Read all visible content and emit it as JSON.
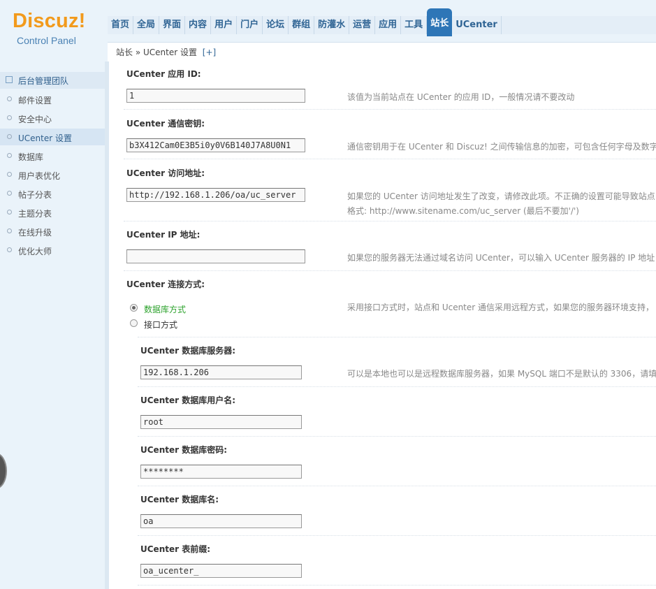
{
  "logo": {
    "main": "Discuz!",
    "sub": "Control Panel"
  },
  "nav": {
    "items": [
      "首页",
      "全局",
      "界面",
      "内容",
      "用户",
      "门户",
      "论坛",
      "群组",
      "防灌水",
      "运营",
      "应用",
      "工具",
      "站长",
      "UCenter"
    ],
    "active": "站长"
  },
  "breadcrumb": {
    "text": "站长 » UCenter 设置",
    "plus": "[+]"
  },
  "sidebar": {
    "group": "后台管理团队",
    "items": [
      "邮件设置",
      "安全中心",
      "UCenter 设置",
      "数据库",
      "用户表优化",
      "帖子分表",
      "主题分表",
      "在线升级",
      "优化大师"
    ],
    "active": "UCenter 设置"
  },
  "form": {
    "app_id": {
      "label": "UCenter 应用 ID:",
      "value": "1",
      "tip": "该值为当前站点在 UCenter 的应用 ID，一般情况请不要改动"
    },
    "comm_key": {
      "label": "UCenter 通信密钥:",
      "value": "b3X412Cam0E3B5i0y0V6B140J7A8U0N1",
      "tip": "通信密钥用于在 UCenter 和 Discuz! 之间传输信息的加密，可包含任何字母及数字"
    },
    "url": {
      "label": "UCenter 访问地址:",
      "value": "http://192.168.1.206/oa/uc_server",
      "tip1": "如果您的 UCenter 访问地址发生了改变，请修改此项。不正确的设置可能导致站点",
      "tip2": "格式: http://www.sitename.com/uc_server (最后不要加'/')"
    },
    "ip": {
      "label": "UCenter IP 地址:",
      "value": "",
      "tip": "如果您的服务器无法通过域名访问 UCenter，可以输入 UCenter 服务器的 IP 地址"
    },
    "connect": {
      "label": "UCenter 连接方式:",
      "option_db": "数据库方式",
      "option_api": "接口方式",
      "selected": "数据库方式",
      "tip": "采用接口方式时，站点和 Ucenter 通信采用远程方式，如果您的服务器环境支持，"
    },
    "db_host": {
      "label": "UCenter 数据库服务器:",
      "value": "192.168.1.206",
      "tip": "可以是本地也可以是远程数据库服务器，如果 MySQL 端口不是默认的 3306，请填"
    },
    "db_user": {
      "label": "UCenter 数据库用户名:",
      "value": "root"
    },
    "db_pass": {
      "label": "UCenter 数据库密码:",
      "value": "********"
    },
    "db_name": {
      "label": "UCenter 数据库名:",
      "value": "oa"
    },
    "db_prefix": {
      "label": "UCenter 表前缀:",
      "value": "oa_ucenter_"
    }
  },
  "colors": {
    "accent": "#2e76b7",
    "logo": "#f29a1c",
    "sidebar_bg": "#eaf3fa",
    "selected_option": "#2ea32e"
  }
}
